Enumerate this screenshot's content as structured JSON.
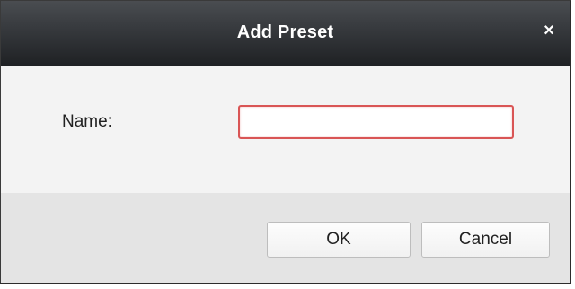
{
  "dialog": {
    "title": "Add Preset",
    "close_label": "×"
  },
  "form": {
    "name_label": "Name:",
    "name_value": "",
    "name_placeholder": ""
  },
  "buttons": {
    "ok_label": "OK",
    "cancel_label": "Cancel"
  },
  "colors": {
    "titlebar": "#2b2d31",
    "input_focus_border": "#d95555",
    "footer_background": "#e4e4e4"
  }
}
